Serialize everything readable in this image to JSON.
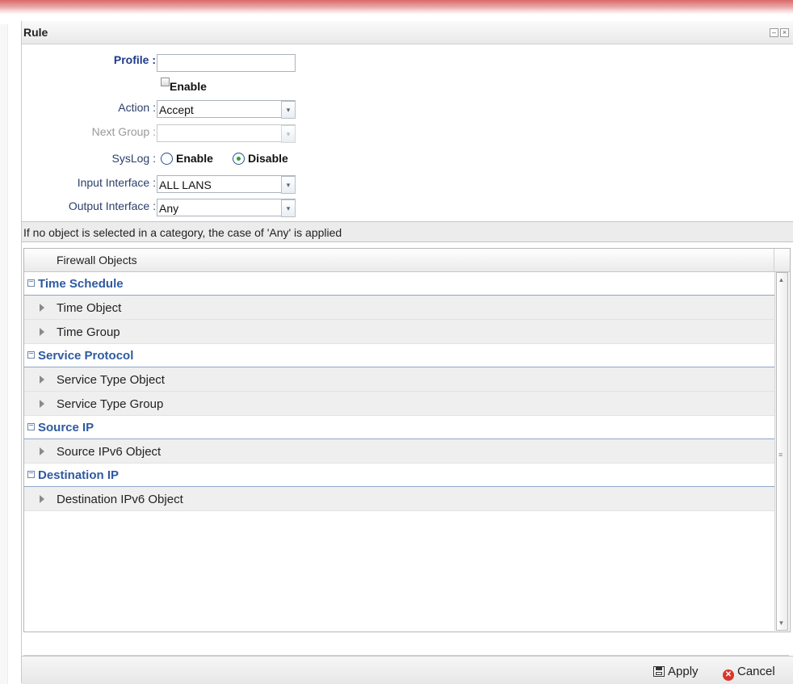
{
  "window": {
    "title": "Rule"
  },
  "form": {
    "profile_label": "Profile :",
    "profile_value": "",
    "enable_label": "Enable",
    "action_label": "Action :",
    "action_value": "Accept",
    "next_group_label": "Next Group :",
    "next_group_value": "",
    "syslog_label": "SysLog :",
    "syslog_enable_label": "Enable",
    "syslog_disable_label": "Disable",
    "syslog_selected": "Disable",
    "input_interface_label": "Input Interface :",
    "input_interface_value": "ALL LANS",
    "output_interface_label": "Output Interface :",
    "output_interface_value": "Any"
  },
  "info_text": "If no object is selected in a category, the case of 'Any' is applied",
  "grid": {
    "header": "Firewall Objects",
    "groups": [
      {
        "label": "Time Schedule",
        "items": [
          "Time Object",
          "Time Group"
        ]
      },
      {
        "label": "Service Protocol",
        "items": [
          "Service Type Object",
          "Service Type Group"
        ]
      },
      {
        "label": "Source IP",
        "items": [
          "Source IPv6 Object"
        ]
      },
      {
        "label": "Destination IP",
        "items": [
          "Destination IPv6 Object"
        ]
      }
    ]
  },
  "footer": {
    "apply_label": "Apply",
    "cancel_label": "Cancel"
  },
  "colors": {
    "group_text": "#2f5aa0",
    "label_text": "#2b3f6b",
    "radio_dot": "#2ea043",
    "cancel_icon": "#d9352b"
  }
}
